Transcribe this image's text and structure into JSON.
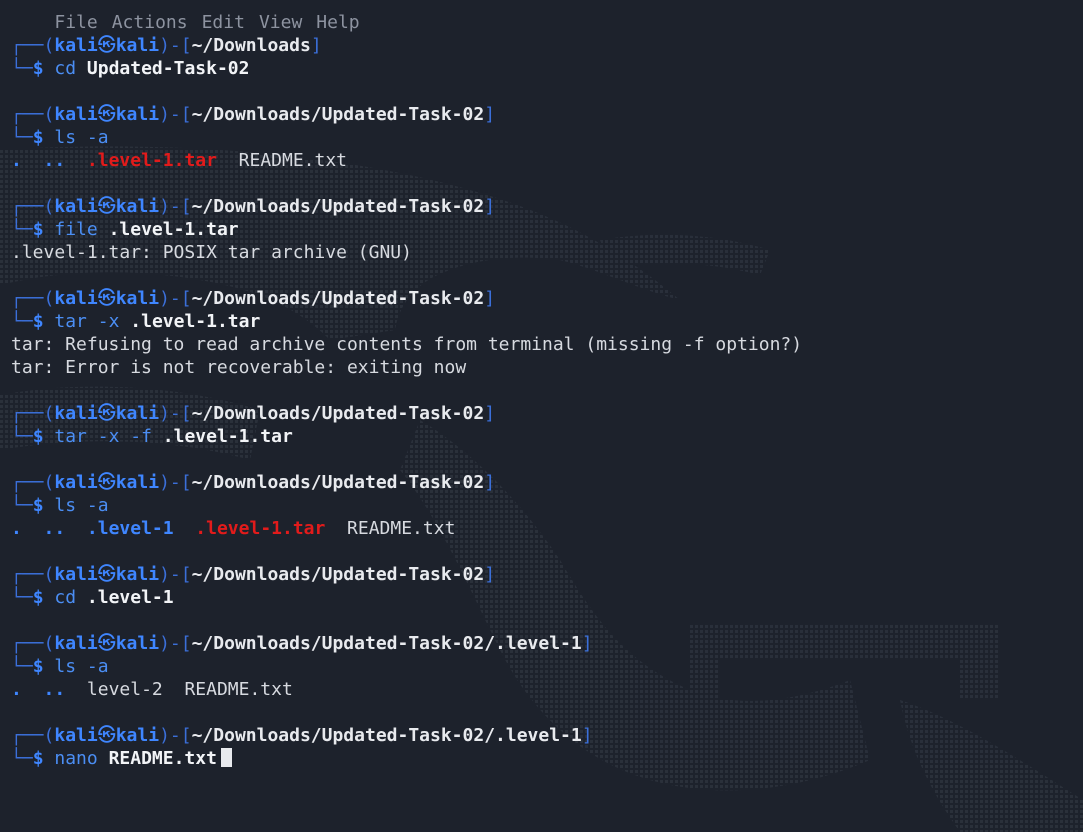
{
  "menu": [
    "File",
    "Actions",
    "Edit",
    "View",
    "Help"
  ],
  "prompt": {
    "open": "┌──(",
    "user": "kali",
    "symbol": "㉿",
    "host": "kali",
    "mid": ")-[",
    "close": "]",
    "corner": "└─",
    "dollar": "$"
  },
  "blocks": [
    {
      "path": "~/Downloads",
      "cmd": "cd",
      "args": "Updated-Task-02",
      "output": []
    },
    {
      "path": "~/Downloads/Updated-Task-02",
      "cmd": "ls",
      "args": "-a",
      "output": [
        {
          "type": "listing",
          "items": [
            {
              "text": ".",
              "kind": "dir"
            },
            {
              "text": "..",
              "kind": "dir"
            },
            {
              "text": ".level-1.tar",
              "kind": "tarfile"
            },
            {
              "text": "README.txt",
              "kind": "file"
            }
          ]
        }
      ]
    },
    {
      "path": "~/Downloads/Updated-Task-02",
      "cmd": "file",
      "args": ".level-1.tar",
      "output": [
        {
          "type": "text",
          "text": ".level-1.tar: POSIX tar archive (GNU)"
        }
      ]
    },
    {
      "path": "~/Downloads/Updated-Task-02",
      "cmd": "tar",
      "flags": "-x",
      "args": ".level-1.tar",
      "output": [
        {
          "type": "text",
          "text": "tar: Refusing to read archive contents from terminal (missing -f option?)"
        },
        {
          "type": "text",
          "text": "tar: Error is not recoverable: exiting now"
        }
      ]
    },
    {
      "path": "~/Downloads/Updated-Task-02",
      "cmd": "tar",
      "flags": "-x -f",
      "args": ".level-1.tar",
      "output": []
    },
    {
      "path": "~/Downloads/Updated-Task-02",
      "cmd": "ls",
      "args": "-a",
      "output": [
        {
          "type": "listing",
          "items": [
            {
              "text": ".",
              "kind": "dir"
            },
            {
              "text": "..",
              "kind": "dir"
            },
            {
              "text": ".level-1",
              "kind": "dir"
            },
            {
              "text": ".level-1.tar",
              "kind": "tarfile"
            },
            {
              "text": "README.txt",
              "kind": "file"
            }
          ]
        }
      ]
    },
    {
      "path": "~/Downloads/Updated-Task-02",
      "cmd": "cd",
      "args": ".level-1",
      "output": []
    },
    {
      "path": "~/Downloads/Updated-Task-02/.level-1",
      "cmd": "ls",
      "args": "-a",
      "output": [
        {
          "type": "listing",
          "items": [
            {
              "text": ".",
              "kind": "dir"
            },
            {
              "text": "..",
              "kind": "dir"
            },
            {
              "text": "level-2",
              "kind": "file"
            },
            {
              "text": "README.txt",
              "kind": "file"
            }
          ]
        }
      ]
    },
    {
      "path": "~/Downloads/Updated-Task-02/.level-1",
      "cmd": "nano",
      "args": "README.txt",
      "output": [],
      "cursor": true
    }
  ]
}
